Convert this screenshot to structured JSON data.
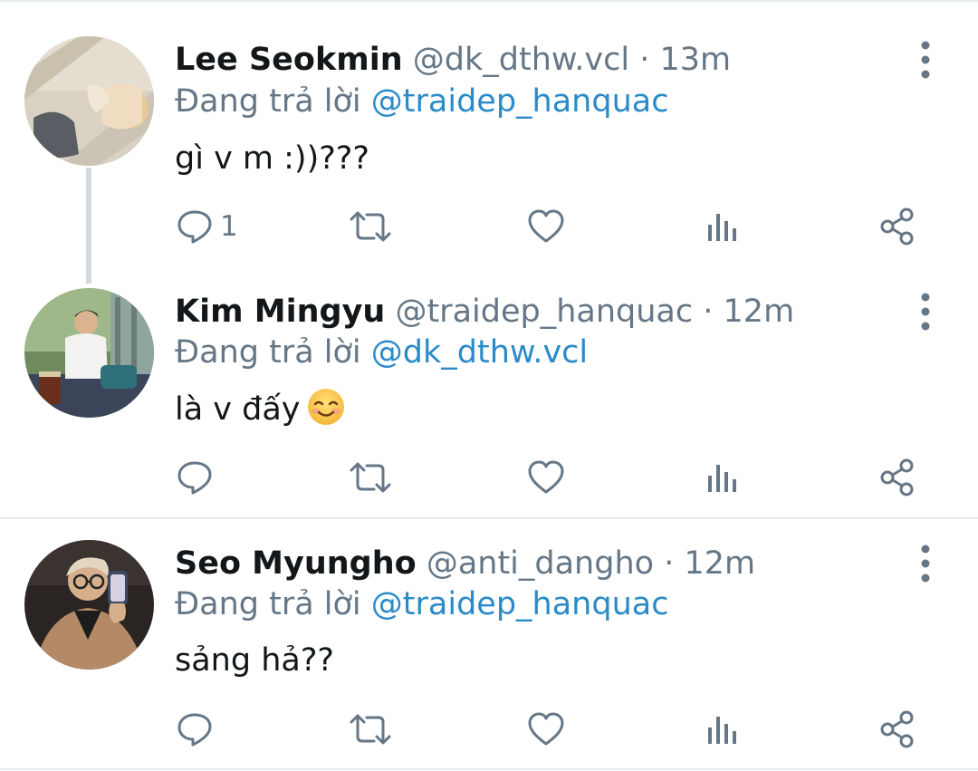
{
  "colors": {
    "accent_link": "#2a8bc9",
    "secondary_text": "#657786",
    "primary_text": "#14171a",
    "divider": "#e6ecf0",
    "thread_line": "#d4dbe0"
  },
  "tweets": [
    {
      "name": "Lee Seokmin",
      "handle": "@dk_dthw.vcl",
      "separator": "·",
      "time": "13m",
      "reply_prefix": "Đang trả lời",
      "reply_to": "@traidep_hanquac",
      "text": "gì v m :))???",
      "reply_count": "1",
      "icons": [
        "reply-icon",
        "retweet-icon",
        "like-icon",
        "analytics-icon",
        "share-icon",
        "more-options-icon"
      ]
    },
    {
      "name": "Kim Mingyu",
      "handle": "@traidep_hanquac",
      "separator": "·",
      "time": "12m",
      "reply_prefix": "Đang trả lời",
      "reply_to": "@dk_dthw.vcl",
      "text": "là v đấy",
      "emoji": "smiling-face-emoji",
      "reply_count": "",
      "icons": [
        "reply-icon",
        "retweet-icon",
        "like-icon",
        "analytics-icon",
        "share-icon",
        "more-options-icon"
      ]
    },
    {
      "name": "Seo Myungho",
      "handle": "@anti_dangho",
      "separator": "·",
      "time": "12m",
      "reply_prefix": "Đang trả lời",
      "reply_to": "@traidep_hanquac",
      "text": "sảng hả??",
      "reply_count": "",
      "icons": [
        "reply-icon",
        "retweet-icon",
        "like-icon",
        "analytics-icon",
        "share-icon",
        "more-options-icon"
      ]
    }
  ]
}
